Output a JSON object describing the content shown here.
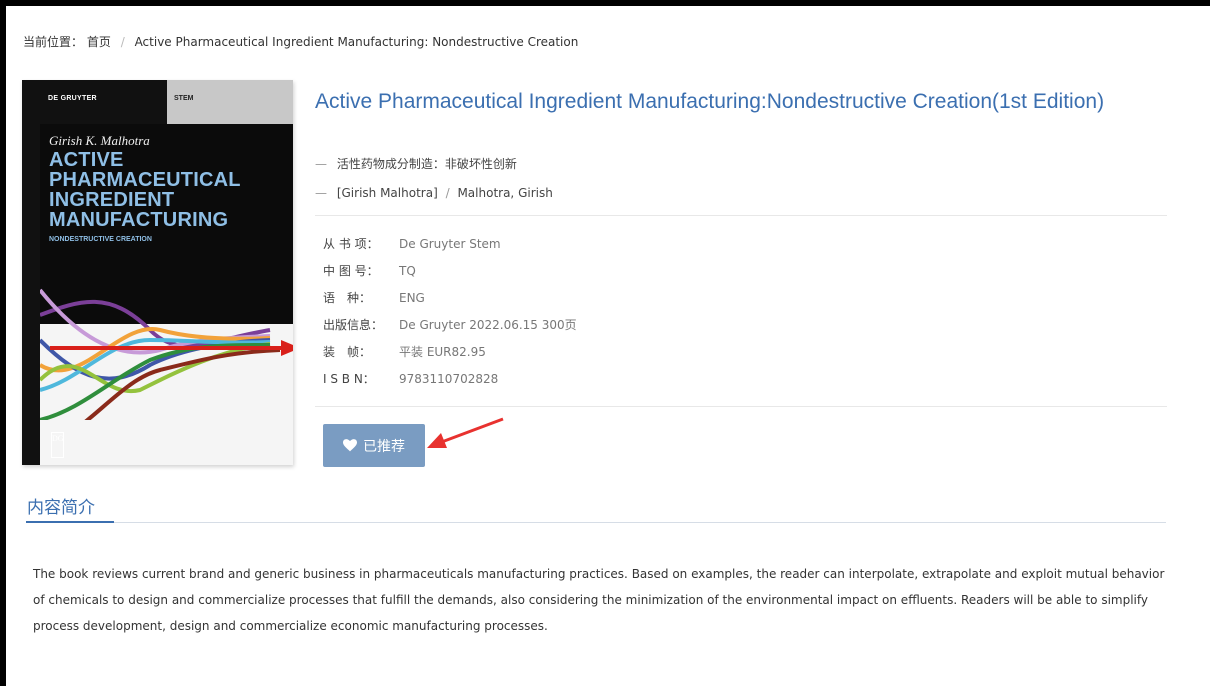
{
  "breadcrumb": {
    "prefix": "当前位置：",
    "home": "首页",
    "separator": "/",
    "current": "Active Pharmaceutical Ingredient Manufacturing: Nondestructive Creation"
  },
  "cover": {
    "publisher": "DE GRUYTER",
    "series": "STEM",
    "author": "Girish K. Malhotra",
    "title_lines": [
      "ACTIVE",
      "PHARMACEUTICAL",
      "INGREDIENT",
      "MANUFACTURING"
    ],
    "subtitle": "NONDESTRUCTIVE CREATION",
    "logo": "DG"
  },
  "book": {
    "title": "Active Pharmaceutical Ingredient Manufacturing:Nondestructive Creation(1st Edition)",
    "chinese_title": "活性药物成分制造：非破坏性创新",
    "dash": "—",
    "authors_cn": "[Girish Malhotra]",
    "authors_sep": "/",
    "authors_en": "Malhotra, Girish"
  },
  "meta": [
    {
      "label": "从 书 项：",
      "value": "De Gruyter Stem"
    },
    {
      "label": "中 图 号：",
      "value": "TQ"
    },
    {
      "label": "语　种：",
      "value": "ENG"
    },
    {
      "label": "出版信息：",
      "value": "De Gruyter   2022.06.15   300页"
    },
    {
      "label": "装　帧：",
      "value": "平装  EUR82.95"
    },
    {
      "label": "I S B N：",
      "value": "9783110702828"
    }
  ],
  "recommend_button": {
    "label": "已推荐",
    "icon": "heart-icon"
  },
  "section": {
    "title": "内容简介"
  },
  "description": "The book reviews current brand and generic business in pharmaceuticals manufacturing practices. Based on examples, the reader can interpolate, extrapolate and exploit mutual behavior of chemicals to design and commercialize processes that fulfill the demands, also considering the minimization of the environmental impact on effluents. Readers will be able to simplify process development, design and commercialize economic manufacturing processes.",
  "colors": {
    "link_blue": "#3b6fb0",
    "button_blue": "#7a9cc2",
    "annotation_red": "#e8322f"
  }
}
